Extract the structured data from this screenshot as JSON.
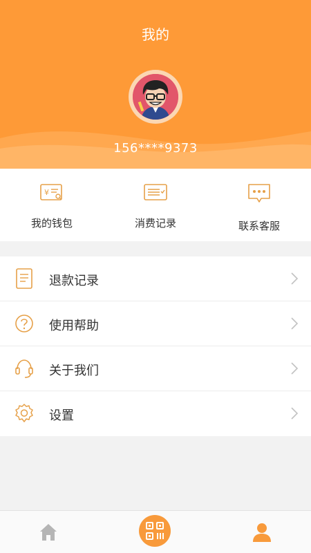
{
  "header": {
    "title": "我的",
    "phone": "156****9373",
    "avatar_icon": "user-avatar-cartoon",
    "background_color": "#fe9a37"
  },
  "quick_actions": [
    {
      "label": "我的钱包",
      "icon": "wallet-icon"
    },
    {
      "label": "消费记录",
      "icon": "receipt-icon"
    },
    {
      "label": "联系客服",
      "icon": "chat-icon"
    }
  ],
  "menu": [
    {
      "label": "退款记录",
      "icon": "document-icon"
    },
    {
      "label": "使用帮助",
      "icon": "help-icon"
    },
    {
      "label": "关于我们",
      "icon": "headset-icon"
    },
    {
      "label": "设置",
      "icon": "gear-icon"
    }
  ],
  "tabbar": {
    "items": [
      {
        "name": "home",
        "icon": "home-icon",
        "active": false
      },
      {
        "name": "scan",
        "icon": "qr-code-icon",
        "active": false
      },
      {
        "name": "profile",
        "icon": "user-icon",
        "active": true
      }
    ],
    "accent_color": "#f89a3b",
    "inactive_color": "#b5b5b5"
  }
}
